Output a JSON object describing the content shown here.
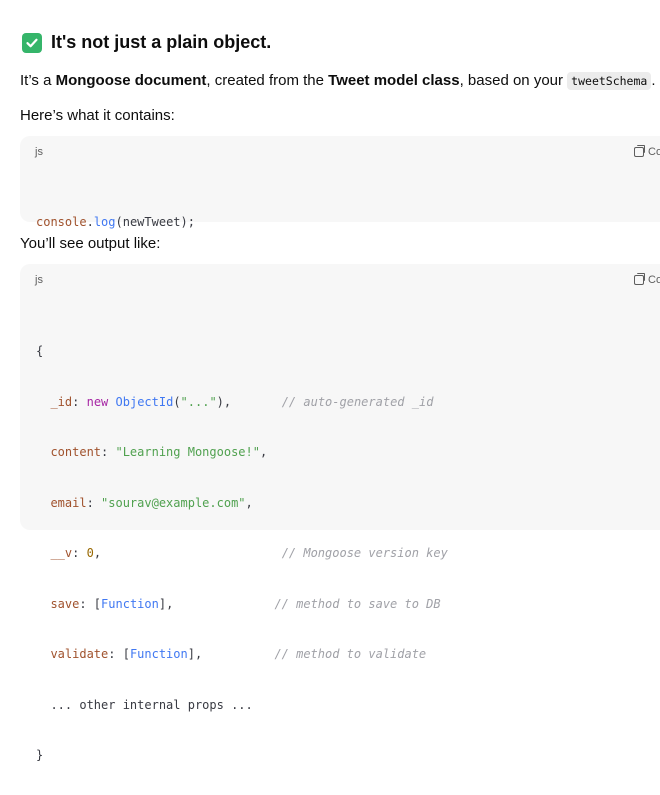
{
  "heading": {
    "text": "It's not just a plain object."
  },
  "intro": {
    "p1": "It’s a ",
    "bold1": "Mongoose document",
    "p2": ", created from the ",
    "bold2": "Tweet model class",
    "p3": ", based on your ",
    "code": "tweetSchema",
    "p4": "."
  },
  "contains_text": "Here’s what it contains:",
  "output_text": "You’ll see output like:",
  "code_block_1": {
    "lang": "js",
    "copy_label": "Co",
    "lines": [
      {
        "obj": "console",
        "dot": ".",
        "fn": "log",
        "rest": "(newTweet);"
      }
    ]
  },
  "code_block_2": {
    "lang": "js",
    "copy_label": "Co",
    "l1": "{",
    "l2": {
      "key": "_id",
      "colon": ": ",
      "kw": "new",
      "sp": " ",
      "cls": "ObjectId",
      "open": "(",
      "str": "\"...\"",
      "close": "),",
      "pad": "       ",
      "comment": "// auto-generated _id"
    },
    "l3": {
      "key": "content",
      "colon": ": ",
      "str": "\"Learning Mongoose!\"",
      "end": ","
    },
    "l4": {
      "key": "email",
      "colon": ": ",
      "str": "\"sourav@example.com\"",
      "end": ","
    },
    "l5": {
      "key": "__v",
      "colon": ": ",
      "num": "0",
      "end": ",",
      "pad": "                         ",
      "comment": "// Mongoose version key"
    },
    "l6": {
      "key": "save",
      "colon": ": [",
      "cls": "Function",
      "end": "],",
      "pad": "              ",
      "comment": "// method to save to DB"
    },
    "l7": {
      "key": "validate",
      "colon": ": [",
      "cls": "Function",
      "end": "],",
      "pad": "          ",
      "comment": "// method to validate"
    },
    "l8": "  ... other internal props ...",
    "l9": "}"
  }
}
